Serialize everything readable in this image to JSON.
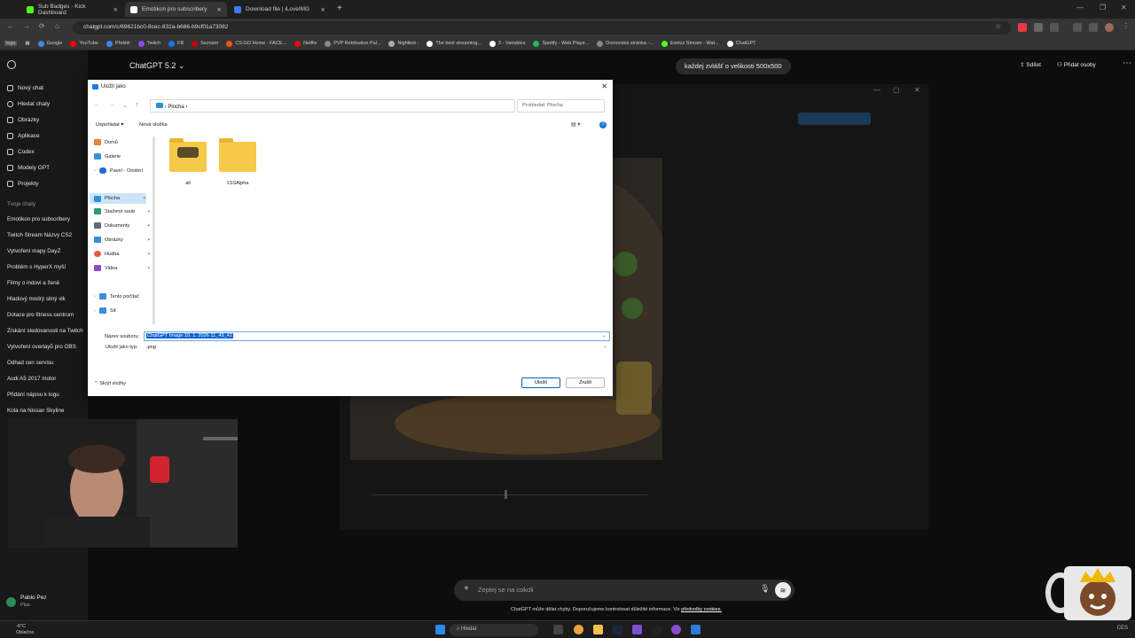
{
  "browser": {
    "tabs": [
      {
        "label": "Sub Badges - Kick Dashboard",
        "color": "#53fc18"
      },
      {
        "label": "Emotikon pro subscribery",
        "color": "#ffffff"
      },
      {
        "label": "Download file | iLoveIMG",
        "color": "#3d7cf5"
      }
    ],
    "url": "chatgpt.com/c/69621bc0-8cec-832a-b686-b9cf01a73082",
    "bookmarks": [
      "logo",
      "Google",
      "YouTube",
      "Překlŵ",
      "Twitch",
      "FB",
      "Seznam",
      "CS:GO Home - FACE...",
      "Netflix",
      "PVP Retribution Pal...",
      "Nightbot -",
      "The best streaming...",
      "3 - Variables",
      "Spotify - Web Playe...",
      "Domovská stránka -...",
      "Exetzz Stream - Wat...",
      "ChatGPT"
    ]
  },
  "sidebar": {
    "nav": [
      "Nový chat",
      "Hledat chaty",
      "Obrázky",
      "Aplikace",
      "Codex",
      "Modely GPT",
      "Projekty"
    ],
    "section": "Tvoje chaty",
    "chats": [
      "Emotikon pro subscribery",
      "Twitch Stream Názvy CS2",
      "Vytvoření mapy DayZ",
      "Problém s HyperX myší",
      "Filmy o indovi a ženě",
      "Hladový modrý silný vlk",
      "Dotace pro fitness centrum",
      "Získání sledovanosti na Twitch",
      "Vytvoření overlayů pro OBS",
      "Odhad cen servisu",
      "Audi A5 2017 motor",
      "Přidání nápisu k logu",
      "Kola na Nissan Skyline"
    ],
    "user": {
      "name": "Pablo Pez",
      "plan": "Plus"
    }
  },
  "main": {
    "model": "ChatGPT 5.2",
    "bubble": "každej zvlášť o velikosti 500x500",
    "share": "Sdílet",
    "add_people": "Přidat osoby",
    "composer_placeholder": "Zeptej se na cokoli",
    "disclaimer": "ChatGPT může dělat chyby. Doporučujeme kontrolovat důležité informace. Viz",
    "disclaimer_link": "předvolby cookies."
  },
  "dialog": {
    "title": "Uložit jako",
    "path": "Plocha",
    "search_placeholder": "Prohledat: Plocha",
    "organize": "Uspořádat",
    "new_folder": "Nová složka",
    "nav_items": [
      "Domů",
      "Galerie",
      "Pavel - Osobní",
      "Plocha",
      "Stažené soub",
      "Dokumenty",
      "Obrázky",
      "Hudba",
      "Videa",
      "Tento počítač",
      "Síť"
    ],
    "folders": [
      "all",
      "1SSAlpha"
    ],
    "filename_label": "Název souboru:",
    "filename": "ChatGPT Image 10. 1. 2026 11_49_42",
    "filetype_label": "Uložit jako typ:",
    "filetype": ".png",
    "hide_folders": "Skrýt složky",
    "save": "Uložit",
    "cancel": "Zrušit"
  },
  "taskbar": {
    "search": "Hledat",
    "weather_temp": "-6°C",
    "weather_desc": "Oblačno",
    "lang": "CES"
  }
}
